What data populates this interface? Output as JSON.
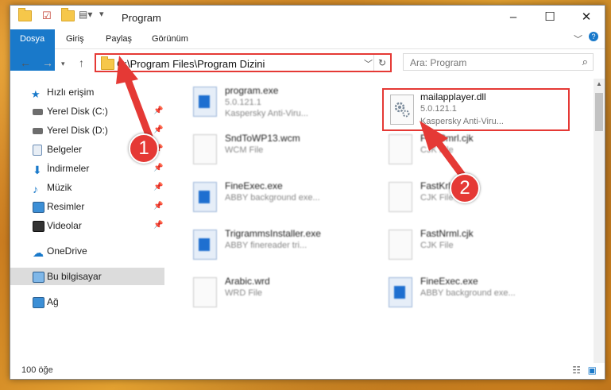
{
  "window": {
    "title": "Program"
  },
  "ribbon": {
    "tabs": [
      "Dosya",
      "Giriş",
      "Paylaş",
      "Görünüm"
    ]
  },
  "address": {
    "path": "C:\\Program Files\\Program Dizini"
  },
  "search": {
    "placeholder": "Ara: Program"
  },
  "sidebar": {
    "items": [
      {
        "label": "Hızlı erişim",
        "icon": "star-icon",
        "pinned": false
      },
      {
        "label": "Yerel Disk (C:)",
        "icon": "drive-icon",
        "pinned": true
      },
      {
        "label": "Yerel Disk (D:)",
        "icon": "drive-icon",
        "pinned": true
      },
      {
        "label": "Belgeler",
        "icon": "documents-icon",
        "pinned": true
      },
      {
        "label": "İndirmeler",
        "icon": "download-icon",
        "pinned": true
      },
      {
        "label": "Müzik",
        "icon": "music-icon",
        "pinned": true
      },
      {
        "label": "Resimler",
        "icon": "pictures-icon",
        "pinned": true
      },
      {
        "label": "Videolar",
        "icon": "video-icon",
        "pinned": true
      },
      {
        "label": "OneDrive",
        "icon": "cloud-icon",
        "pinned": false
      },
      {
        "label": "Bu bilgisayar",
        "icon": "computer-icon",
        "pinned": false
      },
      {
        "label": "Ağ",
        "icon": "network-icon",
        "pinned": false
      }
    ]
  },
  "files": [
    {
      "name": "program.exe",
      "line2": "5.0.121.1",
      "line3": "Kaspersky Anti-Viru...",
      "type": "exe"
    },
    {
      "name": "SndToWP13.wcm",
      "line2": "WCM File",
      "line3": "",
      "type": "file"
    },
    {
      "name": "FineCmrl.cjk",
      "line2": "CJK File",
      "line3": "",
      "type": "file"
    },
    {
      "name": "FineExec.exe",
      "line2": "ABBY background exe...",
      "line3": "",
      "type": "exe"
    },
    {
      "name": "FastKrl.cjk",
      "line2": "CJK File",
      "line3": "",
      "type": "file"
    },
    {
      "name": "TrigrammsInstaller.exe",
      "line2": "ABBY finereader tri...",
      "line3": "",
      "type": "exe"
    },
    {
      "name": "FastNrml.cjk",
      "line2": "CJK File",
      "line3": "",
      "type": "file"
    },
    {
      "name": "Arabic.wrd",
      "line2": "WRD File",
      "line3": "",
      "type": "file"
    },
    {
      "name": "FineExec.exe",
      "line2": "ABBY background exe...",
      "line3": "",
      "type": "exe"
    }
  ],
  "highlighted_file": {
    "name": "mailapplayer.dll",
    "line2": "5.0.121.1",
    "line3": "Kaspersky Anti-Viru..."
  },
  "status": {
    "count": "100 öğe"
  },
  "badges": {
    "one": "1",
    "two": "2"
  },
  "colors": {
    "accent": "#1979ca",
    "highlight": "#e53935"
  }
}
